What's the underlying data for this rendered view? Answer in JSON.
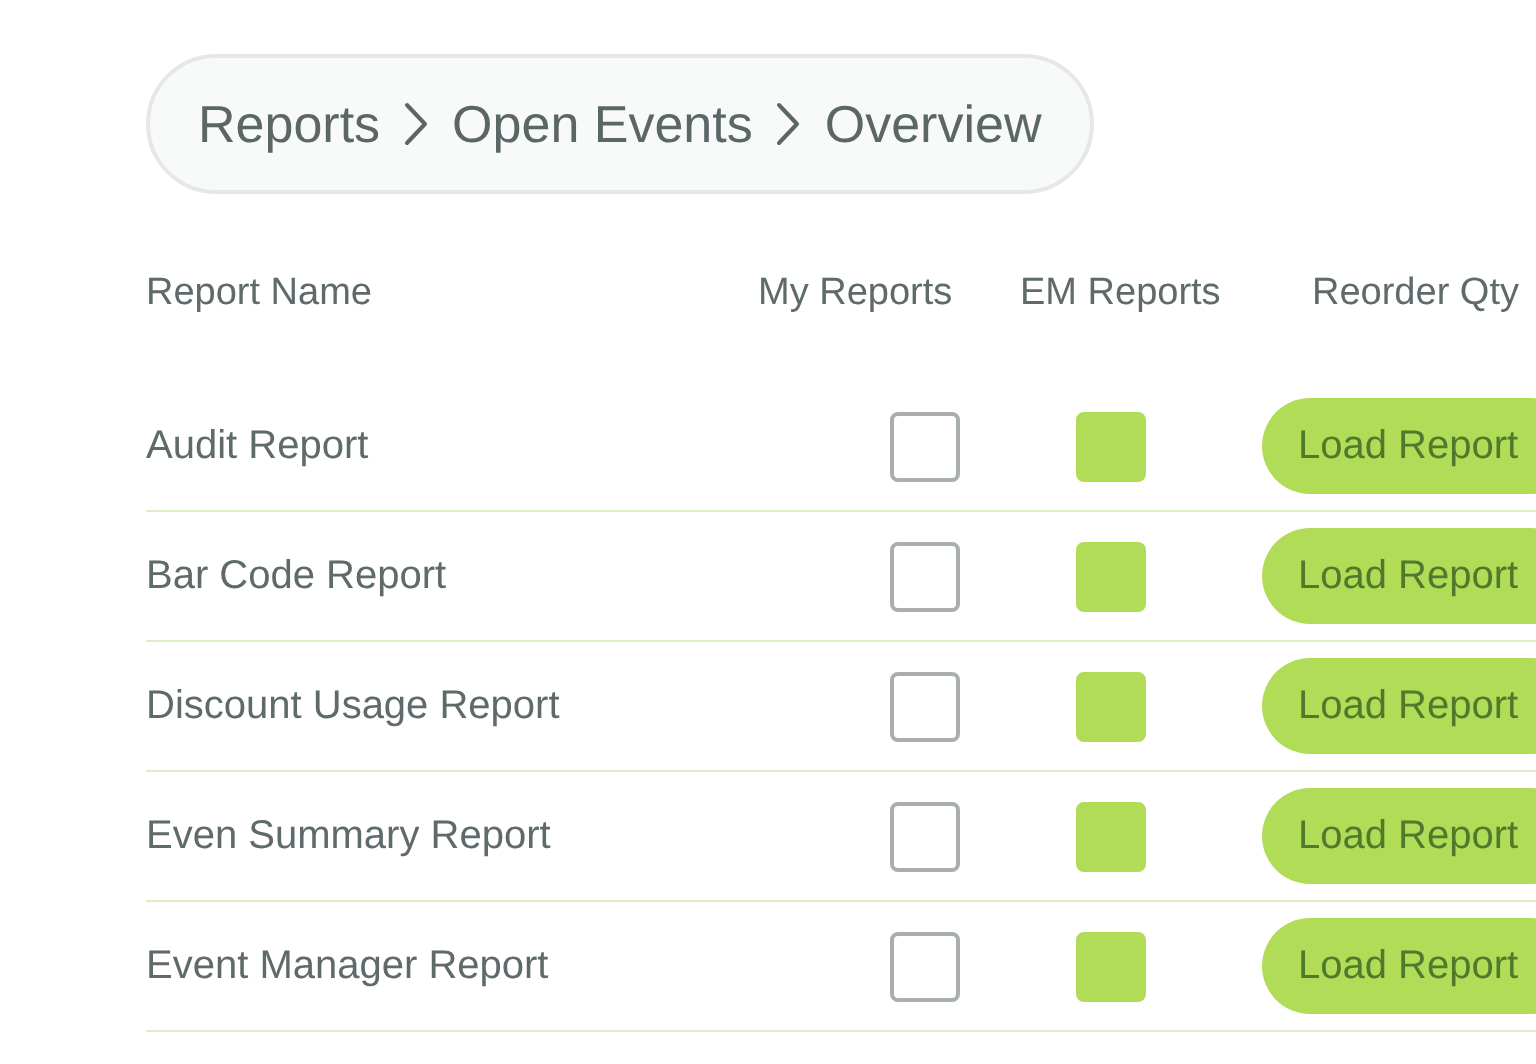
{
  "breadcrumb": [
    "Reports",
    "Open Events",
    "Overview"
  ],
  "table": {
    "columns": [
      "Report Name",
      "My Reports",
      "EM Reports",
      "Reorder Qty"
    ],
    "rows": [
      {
        "name": "Audit Report",
        "my_reports": false,
        "em_reports": true,
        "action": "Load Report"
      },
      {
        "name": "Bar Code Report",
        "my_reports": false,
        "em_reports": true,
        "action": "Load Report"
      },
      {
        "name": "Discount Usage Report",
        "my_reports": false,
        "em_reports": true,
        "action": "Load Report"
      },
      {
        "name": "Even Summary Report",
        "my_reports": false,
        "em_reports": true,
        "action": "Load Report"
      },
      {
        "name": "Event Manager Report",
        "my_reports": false,
        "em_reports": true,
        "action": "Load Report"
      }
    ]
  }
}
